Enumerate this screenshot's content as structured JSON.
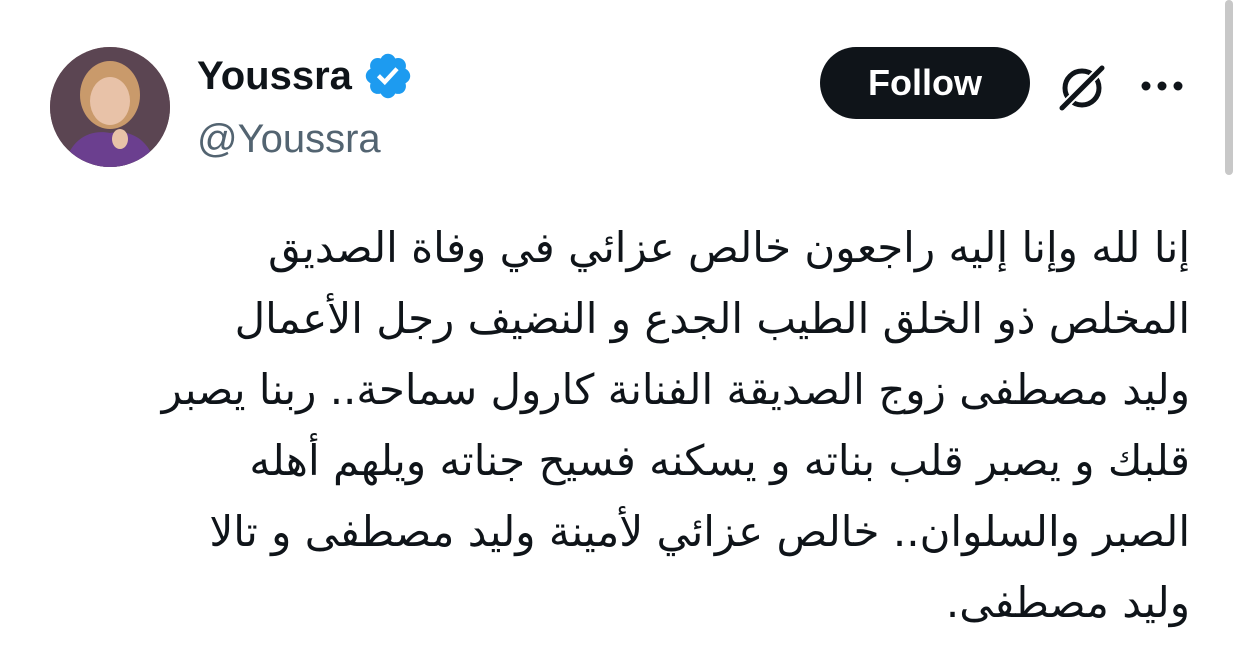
{
  "author": {
    "display_name": "Youssra",
    "handle": "@Youssra",
    "verified_icon": "verified-badge-icon",
    "verified_color": "#1d9bf0"
  },
  "actions": {
    "follow_label": "Follow",
    "grok_icon": "grok-icon",
    "more_icon": "more-options-icon"
  },
  "tweet": {
    "lines": [
      "إنا لله وإنا إليه راجعون خالص عزائي في وفاة الصديق",
      "المخلص ذو الخلق الطيب الجدع و النضيف رجل الأعمال",
      "وليد مصطفى زوج الصديقة الفنانة كارول سماحة.. ربنا يصبر",
      "قلبك و يصبر قلب بناته و يسكنه فسيح جناته ويلهم أهله",
      "الصبر والسلوان.. خالص عزائي لأمينة وليد مصطفى و تالا",
      "وليد مصطفى."
    ]
  },
  "colors": {
    "text": "#0f1419",
    "secondary": "#536471",
    "button_bg": "#0f1419",
    "button_text": "#ffffff"
  }
}
